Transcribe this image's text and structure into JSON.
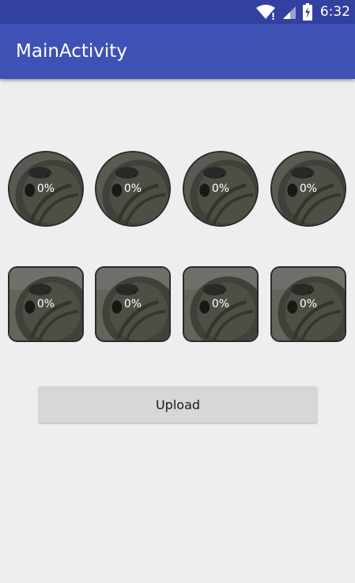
{
  "status_bar": {
    "time": "6:32",
    "icons": [
      "wifi-icon",
      "signal-icon",
      "battery-charging-icon"
    ]
  },
  "app_bar": {
    "title": "MainActivity"
  },
  "circle_row": [
    {
      "progress": "0%"
    },
    {
      "progress": "0%"
    },
    {
      "progress": "0%"
    },
    {
      "progress": "0%"
    }
  ],
  "rounded_row": [
    {
      "progress": "0%"
    },
    {
      "progress": "0%"
    },
    {
      "progress": "0%"
    },
    {
      "progress": "0%"
    }
  ],
  "upload_button": {
    "label": "Upload"
  },
  "colors": {
    "status_bar": "#3241a0",
    "app_bar": "#3f51b5",
    "background": "#eeeeee",
    "button": "#d6d7d7"
  }
}
